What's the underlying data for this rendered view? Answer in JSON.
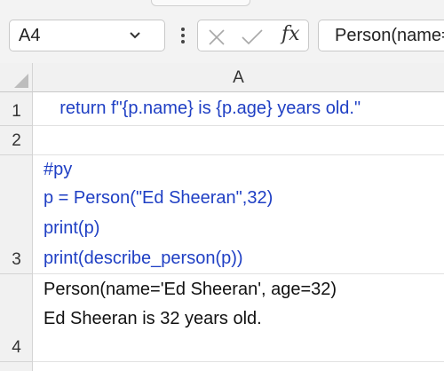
{
  "name_box": {
    "value": "A4"
  },
  "formula_bar": {
    "fx_label": "fx",
    "value": "Person(name='Ed Sheeran', age=32)"
  },
  "columns": [
    "A"
  ],
  "rows": [
    {
      "label": "1",
      "lines": [
        "    return f\"{p.name} is {p.age} years old.\""
      ]
    },
    {
      "label": "2",
      "lines": []
    },
    {
      "label": "3",
      "lines": [
        "#py",
        "p = Person(\"Ed Sheeran\",32)",
        "print(p)",
        "print(describe_person(p))"
      ]
    },
    {
      "label": "4",
      "lines": [
        "Person(name='Ed Sheeran', age=32)",
        "Ed Sheeran is 32 years old."
      ]
    }
  ],
  "colors": {
    "code_text": "#1f3fc4",
    "output_text": "#111111"
  }
}
